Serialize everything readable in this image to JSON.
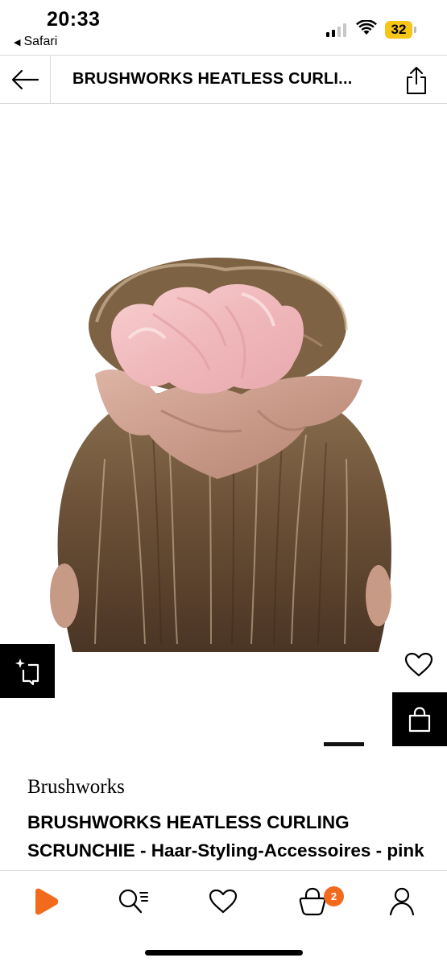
{
  "status_bar": {
    "time": "20:33",
    "back_app": "Safari",
    "back_arrow": "◀",
    "battery": "32",
    "battery_color": "#f5c518"
  },
  "nav": {
    "title": "BRUSHWORKS HEATLESS CURLI...",
    "back_icon": "arrow-left-icon",
    "share_icon": "share-icon"
  },
  "product": {
    "image": "scrunchie-on-hair-bun-photo",
    "brand": "Brushworks",
    "name": "BRUSHWORKS HEATLESS CURLING SCRUNCHIE - Haar-Styling-Accessoires - pink & beige",
    "ar_icon": "ar-try-on-icon",
    "wishlist_icon": "heart-icon",
    "bag_icon": "shopping-bag-icon"
  },
  "tab_bar": {
    "items": [
      {
        "name": "home",
        "icon": "zalando-play-icon",
        "color": "#f26b1d"
      },
      {
        "name": "search",
        "icon": "search-icon"
      },
      {
        "name": "wishlist",
        "icon": "heart-icon"
      },
      {
        "name": "bag",
        "icon": "bag-icon"
      },
      {
        "name": "account",
        "icon": "user-icon"
      }
    ],
    "bag_badge": "2"
  }
}
